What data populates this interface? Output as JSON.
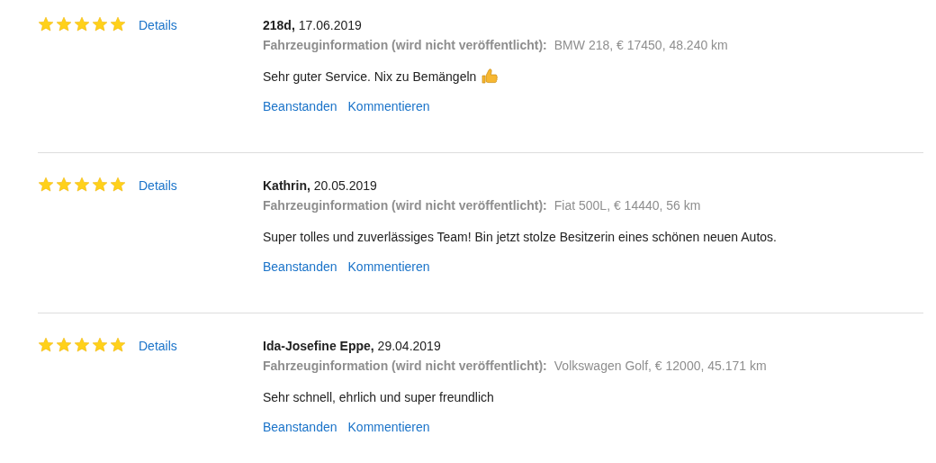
{
  "reviews": [
    {
      "stars": 5,
      "details": "Details",
      "header": "**218d,** 17.06.2019",
      "vehicle_label": "Fahrzeuginformation (wird nicht veröffentlicht):",
      "vehicle_value": "BMW 218, € 17450, 48.240 km",
      "text": "Sehr guter Service. Nix zu Bemängeln",
      "thumbs_up": true,
      "actions": [
        "Beanstanden",
        "Kommentieren"
      ]
    },
    {
      "stars": 5,
      "details": "Details",
      "header": "**Kathrin,** 20.05.2019",
      "vehicle_label": "Fahrzeuginformation (wird nicht veröffentlicht):",
      "vehicle_value": "Fiat 500L, € 14440, 56 km",
      "text": "Super tolles und zuverlässiges Team! Bin jetzt stolze Besitzerin eines schönen neuen Autos.",
      "actions": [
        "Beanstanden",
        "Kommentieren"
      ]
    },
    {
      "stars": 5,
      "details": "Details",
      "header": "**Ida-Josefine Eppe,** 29.04.2019",
      "vehicle_label": "Fahrzeuginformation (wird nicht veröffentlicht):",
      "vehicle_value": "Volkswagen Golf, € 12000, 45.171 km",
      "text": "Sehr schnell, ehrlich und super freundlich",
      "actions": [
        "Beanstanden",
        "Kommentieren"
      ]
    }
  ]
}
